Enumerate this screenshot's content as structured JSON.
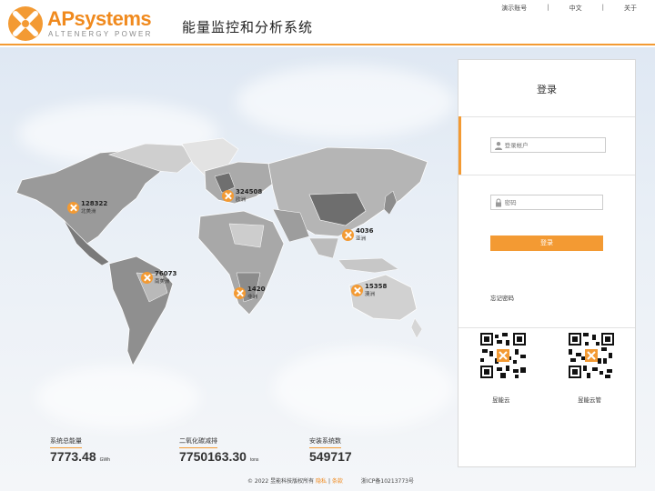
{
  "header": {
    "brand": "APsystems",
    "tagline": "ALTENERGY POWER",
    "title": "能量监控和分析系统",
    "links": [
      "演示账号",
      "中文",
      "关于"
    ]
  },
  "map": {
    "markers": [
      {
        "count": "128322",
        "region": "北美洲"
      },
      {
        "count": "324508",
        "region": "欧洲"
      },
      {
        "count": "4036",
        "region": "亚洲"
      },
      {
        "count": "76073",
        "region": "南美洲"
      },
      {
        "count": "1420",
        "region": "非洲"
      },
      {
        "count": "15358",
        "region": "澳洲"
      }
    ]
  },
  "stats": {
    "energy": {
      "label": "系统总能量",
      "value": "7773.48",
      "unit": "GWh"
    },
    "co2": {
      "label": "二氧化碳减排",
      "value": "7750163.30",
      "unit": "tons"
    },
    "installs": {
      "label": "安装系统数",
      "value": "549717"
    }
  },
  "footer": {
    "copyright": "© 2022 昱能科技版权所有",
    "privacy": "隐私",
    "sep": "|",
    "terms": "条款",
    "icp": "浙ICP备10213773号"
  },
  "login": {
    "title": "登录",
    "account_placeholder": "登录帐户",
    "password_placeholder": "密码",
    "button": "登录",
    "forgot": "忘记密码",
    "qr_left_label": "昱能云",
    "qr_right_label": "昱能云管"
  },
  "colors": {
    "accent": "#f39a33",
    "brand": "#f08a1e"
  }
}
